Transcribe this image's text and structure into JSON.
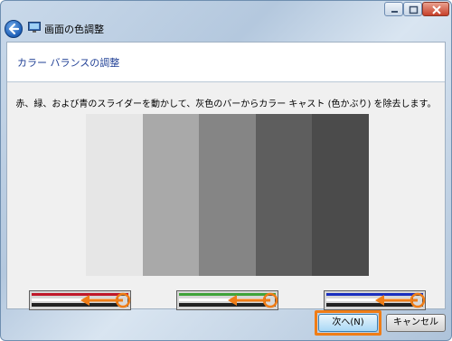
{
  "window": {
    "title": "画面の色調整",
    "controls": [
      "minimize",
      "maximize",
      "close"
    ]
  },
  "header": {
    "title": "カラー バランスの調整"
  },
  "instruction": "赤、緑、および青のスライダーを動かして、灰色のバーからカラー キャスト (色かぶり) を除去します。",
  "gray_bars": [
    {
      "color": "#e6e6e6"
    },
    {
      "color": "#a9a9a9"
    },
    {
      "color": "#858585"
    },
    {
      "color": "#5e5e5e"
    },
    {
      "color": "#4b4b4b"
    }
  ],
  "sliders": [
    {
      "channel": "red",
      "accent": "#c0182a"
    },
    {
      "channel": "green",
      "accent": "#3fa33a"
    },
    {
      "channel": "blue",
      "accent": "#1a2fbf"
    }
  ],
  "buttons": {
    "next": "次へ(N)",
    "cancel": "キャンセル"
  },
  "colors": {
    "highlight": "#f07d16",
    "header_text": "#1f3f95"
  },
  "icons": {
    "back": "back-arrow-icon",
    "app": "monitor-icon"
  }
}
